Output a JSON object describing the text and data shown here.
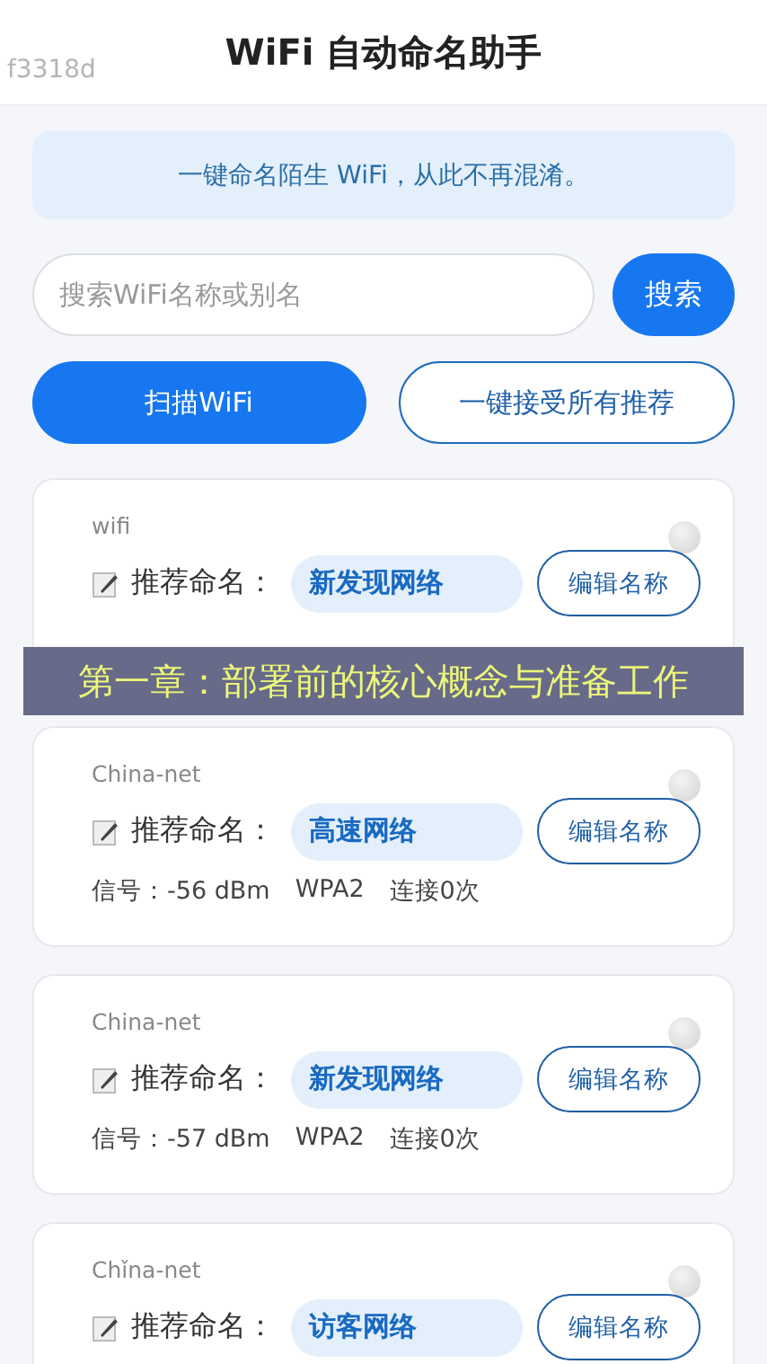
{
  "header": {
    "title": "WiFi 自动命名助手",
    "tag": "f3318d"
  },
  "notice": "一键命名陌生 WiFi，从此不再混淆。",
  "search": {
    "placeholder": "搜索WiFi名称或别名",
    "button": "搜索"
  },
  "actions": [
    {
      "label": "扫描WiFi",
      "kind": "primary"
    },
    {
      "label": "一键接受所有推荐",
      "kind": "outline"
    }
  ],
  "networks": [
    {
      "ssid": "wifi",
      "label": "推荐命名：",
      "suggestion": "新发现网络",
      "edit": "编辑名称"
    },
    {
      "ssid": "China-net",
      "label": "推荐命名：",
      "suggestion": "高速网络",
      "edit": "编辑名称",
      "signal": "信号：-56 dBm",
      "security": "WPA2",
      "connections": "连接0次"
    },
    {
      "ssid": "China-net",
      "label": "推荐命名：",
      "suggestion": "新发现网络",
      "edit": "编辑名称",
      "signal": "信号：-57 dBm",
      "security": "WPA2",
      "connections": "连接0次"
    },
    {
      "ssid": "Chǐna-net",
      "label": "推荐命名：",
      "suggestion": "访客网络",
      "edit": "编辑名称"
    }
  ],
  "overlay_caption": "第一章：部署前的核心概念与准备工作"
}
